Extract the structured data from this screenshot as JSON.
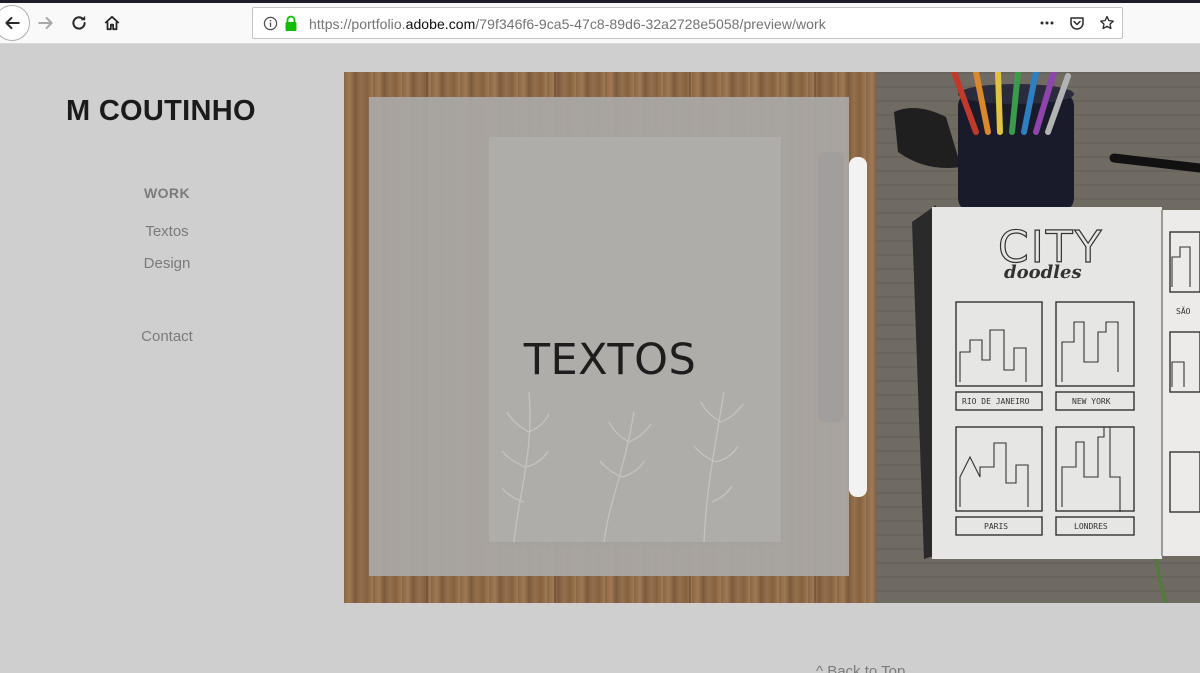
{
  "browser": {
    "url_prefix": "https://portfolio.",
    "url_domain": "adobe.com",
    "url_suffix": "/79f346f6-9ca5-47c8-89d6-32a2728e5058/preview/work",
    "icons": [
      "back-arrow-icon",
      "forward-arrow-icon",
      "reload-icon",
      "home-icon",
      "info-icon",
      "lock-icon",
      "more-dots-icon",
      "pocket-icon",
      "bookmark-star-icon"
    ]
  },
  "site": {
    "title": "M COUTINHO",
    "nav": {
      "work": "WORK",
      "textos": "Textos",
      "design": "Design",
      "contact": "Contact"
    }
  },
  "projects": [
    {
      "label": "TEXTOS"
    },
    {
      "label": ""
    }
  ],
  "sketchbook": {
    "title": "CITY",
    "subtitle": "doodles",
    "captions": [
      "RIO DE JANEIRO",
      "NEW YORK",
      "PARIS",
      "LONDRES",
      "SÃO"
    ]
  },
  "footer": {
    "back_to_top": "^  Back to Top"
  },
  "colors": {
    "page_bg": "#cfcfcf",
    "overlay": "#aaa8a6",
    "title": "#1b1b1b",
    "nav": "#7b7b7b",
    "lock_green": "#12bc00"
  }
}
